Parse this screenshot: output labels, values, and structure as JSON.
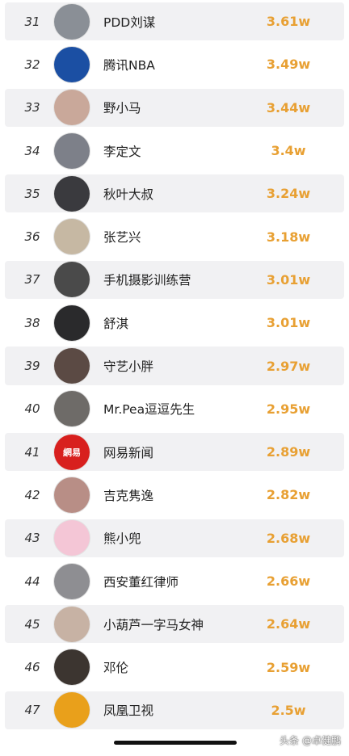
{
  "colors": {
    "value": "#e8a033",
    "band": "#f1f1f3",
    "rank": "#333333",
    "name": "#222222"
  },
  "rows": [
    {
      "rank": "31",
      "name": "PDD刘谋",
      "value": "3.61w",
      "avatar": {
        "icon": "man-sunglasses-avatar",
        "color": "#8a8f96"
      }
    },
    {
      "rank": "32",
      "name": "腾讯NBA",
      "value": "3.49w",
      "avatar": {
        "icon": "basketball-logo-avatar",
        "color": "#1b4fa3"
      }
    },
    {
      "rank": "33",
      "name": "野小马",
      "value": "3.44w",
      "avatar": {
        "icon": "woman-portrait-avatar",
        "color": "#c9a89a"
      }
    },
    {
      "rank": "34",
      "name": "李定文",
      "value": "3.4w",
      "avatar": {
        "icon": "man-suit-avatar",
        "color": "#7d8089"
      }
    },
    {
      "rank": "35",
      "name": "秋叶大叔",
      "value": "3.24w",
      "avatar": {
        "icon": "man-portrait-avatar",
        "color": "#3a3a3e"
      }
    },
    {
      "rank": "36",
      "name": "张艺兴",
      "value": "3.18w",
      "avatar": {
        "icon": "blurred-portrait-avatar",
        "color": "#c6b8a3"
      }
    },
    {
      "rank": "37",
      "name": "手机摄影训练营",
      "value": "3.01w",
      "avatar": {
        "icon": "silhouette-avatar",
        "color": "#4a4a4a"
      }
    },
    {
      "rank": "38",
      "name": "舒淇",
      "value": "3.01w",
      "avatar": {
        "icon": "woman-profile-avatar",
        "color": "#2a2a2c"
      }
    },
    {
      "rank": "39",
      "name": "守艺小胖",
      "value": "2.97w",
      "avatar": {
        "icon": "man-portrait-avatar",
        "color": "#5b4a44"
      }
    },
    {
      "rank": "40",
      "name": "Mr.Pea逗逗先生",
      "value": "2.95w",
      "avatar": {
        "icon": "man-suit-avatar",
        "color": "#6e6b68"
      }
    },
    {
      "rank": "41",
      "name": "网易新闻",
      "value": "2.89w",
      "avatar": {
        "icon": "netease-logo-avatar",
        "color": "#d8201e",
        "text": "網易"
      }
    },
    {
      "rank": "42",
      "name": "吉克隽逸",
      "value": "2.82w",
      "avatar": {
        "icon": "woman-portrait-avatar",
        "color": "#b88e86"
      }
    },
    {
      "rank": "43",
      "name": "熊小兜",
      "value": "2.68w",
      "avatar": {
        "icon": "pink-pig-cartoon-avatar",
        "color": "#f4c6d6"
      }
    },
    {
      "rank": "44",
      "name": "西安董红律师",
      "value": "2.66w",
      "avatar": {
        "icon": "woman-portrait-avatar",
        "color": "#8e8e92"
      }
    },
    {
      "rank": "45",
      "name": "小葫芦一字马女神",
      "value": "2.64w",
      "avatar": {
        "icon": "woman-portrait-avatar",
        "color": "#c7b2a4"
      }
    },
    {
      "rank": "46",
      "name": "邓伦",
      "value": "2.59w",
      "avatar": {
        "icon": "landscape-avatar",
        "color": "#3c3530"
      }
    },
    {
      "rank": "47",
      "name": "凤凰卫视",
      "value": "2.5w",
      "avatar": {
        "icon": "phoenix-logo-avatar",
        "color": "#e9a01b"
      }
    }
  ],
  "watermark": {
    "text": "头条 @卓健鹏"
  }
}
